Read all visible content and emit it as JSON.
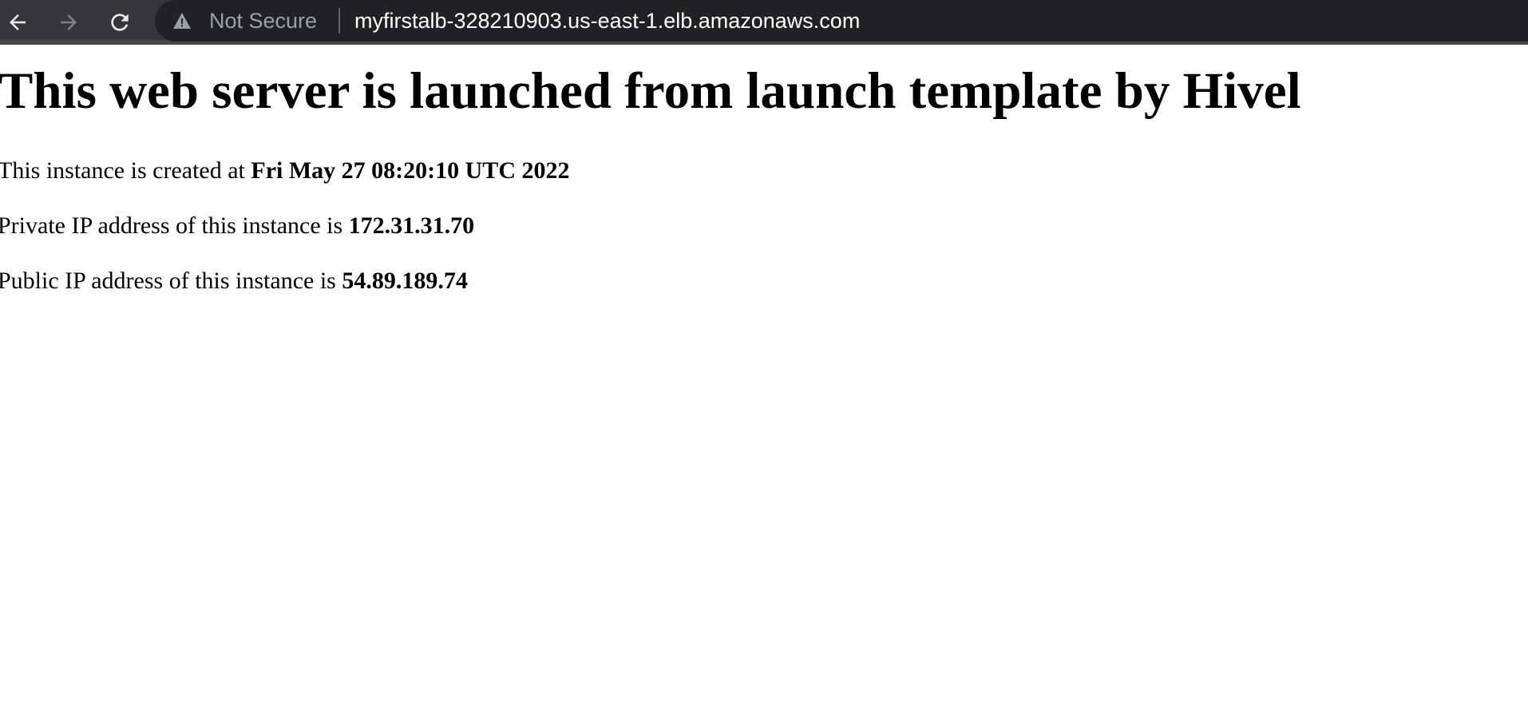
{
  "browser": {
    "security_label": "Not Secure",
    "url": "myfirstalb-328210903.us-east-1.elb.amazonaws.com",
    "icons": {
      "back": "arrow-left-icon",
      "forward": "arrow-right-icon",
      "reload": "reload-icon",
      "security": "warning-triangle-icon"
    }
  },
  "page": {
    "heading": "This web server is launched from launch template by Hivel",
    "created": {
      "label": "This instance is created at ",
      "value": "Fri May 27 08:20:10 UTC 2022"
    },
    "private_ip": {
      "label": "Private IP address of this instance is ",
      "value": "172.31.31.70"
    },
    "public_ip": {
      "label": "Public IP address of this instance is ",
      "value": "54.89.189.74"
    }
  }
}
